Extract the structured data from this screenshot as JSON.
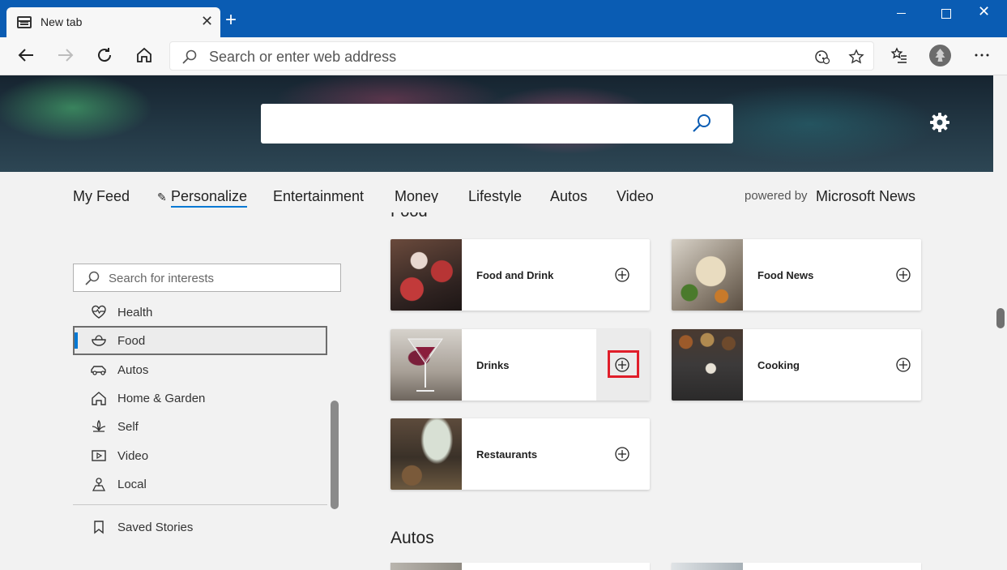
{
  "browser": {
    "tab_title": "New tab",
    "address_placeholder": "Search or enter web address"
  },
  "nav": {
    "items": [
      "My Feed",
      "Personalize",
      "Entertainment",
      "Money",
      "Lifestyle",
      "Autos",
      "Video"
    ],
    "active": "Personalize",
    "powered_by": "powered by",
    "brand": "Microsoft News"
  },
  "sidebar": {
    "search_placeholder": "Search for interests",
    "categories": [
      {
        "label": "Health",
        "icon": "heart-pulse-icon"
      },
      {
        "label": "Food",
        "icon": "food-bowl-icon",
        "selected": true
      },
      {
        "label": "Autos",
        "icon": "car-icon"
      },
      {
        "label": "Home & Garden",
        "icon": "home-icon"
      },
      {
        "label": "Self",
        "icon": "lotus-icon"
      },
      {
        "label": "Video",
        "icon": "video-icon"
      },
      {
        "label": "Local",
        "icon": "map-pin-icon"
      }
    ],
    "saved": {
      "label": "Saved Stories",
      "icon": "bookmark-icon"
    }
  },
  "sections": {
    "food": {
      "title": "Food",
      "cards": [
        {
          "label": "Food and Drink"
        },
        {
          "label": "Food News"
        },
        {
          "label": "Drinks"
        },
        {
          "label": "Cooking"
        },
        {
          "label": "Restaurants"
        }
      ]
    },
    "autos": {
      "title": "Autos"
    }
  },
  "colors": {
    "titlebar": "#0a5cb3",
    "accent": "#0078d4",
    "highlight": "#e01e2a"
  }
}
